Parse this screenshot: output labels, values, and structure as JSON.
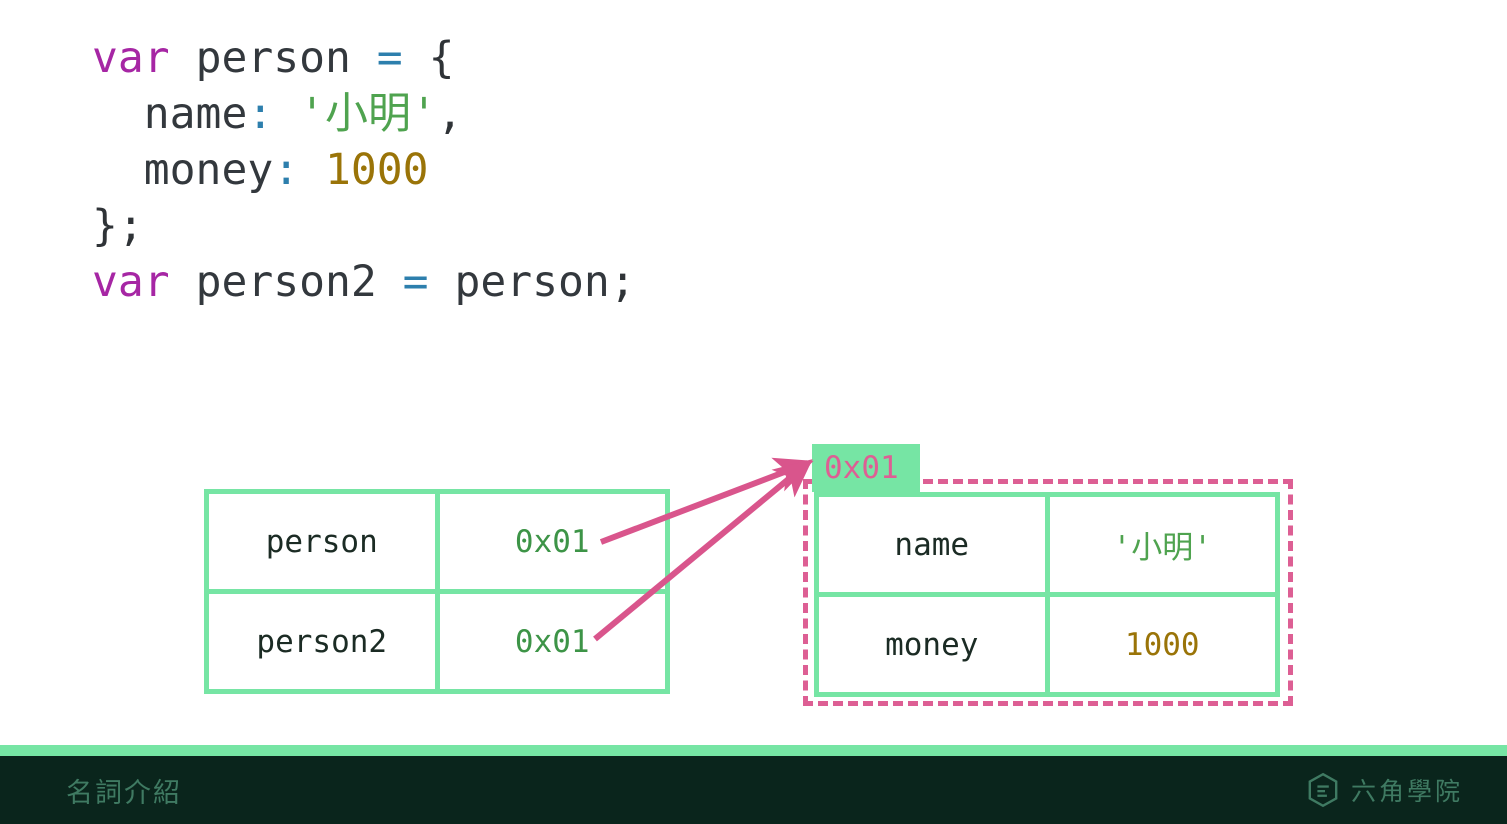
{
  "slide": {
    "background_color": "#ffffff"
  },
  "code": {
    "language": "javascript",
    "lines": [
      "var person = {",
      "  name: '小明',",
      "  money: 1000",
      "};",
      "var person2 = person;"
    ],
    "tokens": {
      "keyword": "var",
      "var1": "person",
      "var2": "person2",
      "prop1": "name",
      "prop2": "money",
      "string_value": "'小明'",
      "number_value": "1000",
      "assign_op": "=",
      "colon": ":",
      "open_brace": "{",
      "close_brace_semi": "};",
      "comma": ",",
      "semicolon": ";"
    },
    "colors": {
      "keyword": "#a626a4",
      "operator": "#2d7fad",
      "string": "#4fa34f",
      "number": "#9a7408",
      "text": "#2f3337"
    }
  },
  "diagram": {
    "stack_table": {
      "label": "variable-reference-table",
      "border_color": "#76e5a4",
      "rows": [
        {
          "name": "person",
          "address": "0x01"
        },
        {
          "name": "person2",
          "address": "0x01"
        }
      ]
    },
    "heap_object": {
      "label": "heap-object-table",
      "address_tag": "0x01",
      "address_tag_bg": "#76e5a4",
      "address_tag_color": "#dd5f94",
      "dashed_border_color": "#dd5f94",
      "border_color": "#76e5a4",
      "rows": [
        {
          "key": "name",
          "value": "'小明'",
          "value_type": "string"
        },
        {
          "key": "money",
          "value": "1000",
          "value_type": "number"
        }
      ]
    },
    "arrows": {
      "color": "#d9558c",
      "count": 2,
      "description": "both reference arrows point to object address 0x01"
    }
  },
  "footer": {
    "stripe_color": "#76e5a4",
    "background_color": "#0a251c",
    "title": "名詞介紹",
    "brand": "六角學院",
    "brand_icon": "hexagon-logo-icon",
    "text_color": "#3f7a62"
  }
}
